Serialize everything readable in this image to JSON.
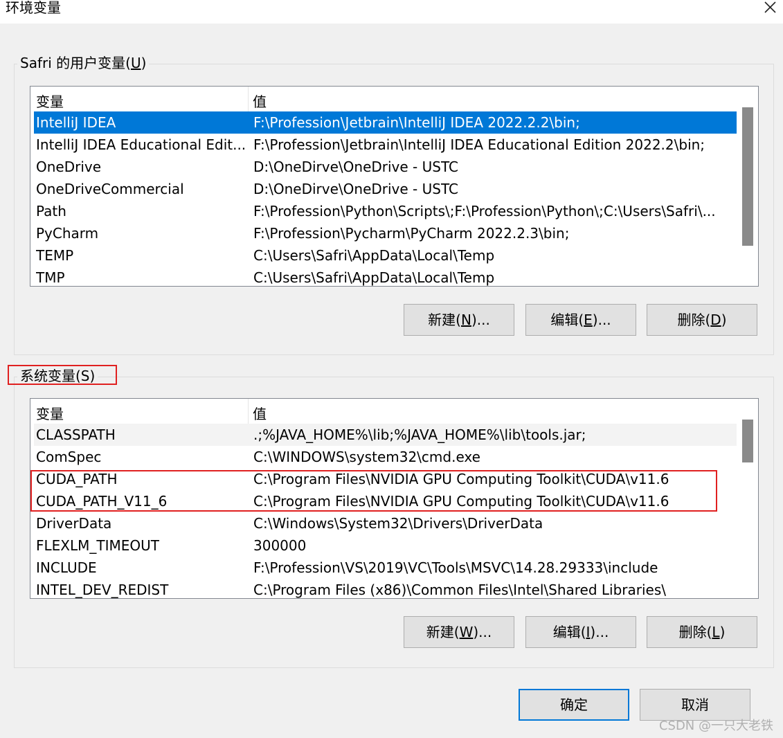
{
  "window": {
    "title": "环境变量",
    "close_icon": "close-icon"
  },
  "user_vars": {
    "group_label_prefix": "Safri 的用户变量(",
    "group_label_key": "U",
    "group_label_suffix": ")",
    "columns": [
      "变量",
      "值"
    ],
    "rows": [
      {
        "name": "IntelliJ IDEA",
        "value": "F:\\Profession\\Jetbrain\\IntelliJ IDEA 2022.2.2\\bin;"
      },
      {
        "name": "IntelliJ IDEA Educational Edit...",
        "value": "F:\\Profession\\Jetbrain\\IntelliJ IDEA Educational Edition 2022.2\\bin;"
      },
      {
        "name": "OneDrive",
        "value": "D:\\OneDirve\\OneDrive - USTC"
      },
      {
        "name": "OneDriveCommercial",
        "value": "D:\\OneDirve\\OneDrive - USTC"
      },
      {
        "name": "Path",
        "value": "F:\\Profession\\Python\\Scripts\\;F:\\Profession\\Python\\;C:\\Users\\Safri\\..."
      },
      {
        "name": "PyCharm",
        "value": "F:\\Profession\\Pycharm\\PyCharm 2022.2.3\\bin;"
      },
      {
        "name": "TEMP",
        "value": "C:\\Users\\Safri\\AppData\\Local\\Temp"
      },
      {
        "name": "TMP",
        "value": "C:\\Users\\Safri\\AppData\\Local\\Temp"
      }
    ],
    "selected_index": 0,
    "buttons": {
      "new": {
        "prefix": "新建(",
        "key": "N",
        "suffix": ")..."
      },
      "edit": {
        "prefix": "编辑(",
        "key": "E",
        "suffix": ")..."
      },
      "delete": {
        "prefix": "删除(",
        "key": "D",
        "suffix": ")"
      }
    }
  },
  "system_vars": {
    "group_label": "系统变量(S)",
    "columns": [
      "变量",
      "值"
    ],
    "rows": [
      {
        "name": "CLASSPATH",
        "value": ".;%JAVA_HOME%\\lib;%JAVA_HOME%\\lib\\tools.jar;"
      },
      {
        "name": "ComSpec",
        "value": "C:\\WINDOWS\\system32\\cmd.exe"
      },
      {
        "name": "CUDA_PATH",
        "value": "C:\\Program Files\\NVIDIA GPU Computing Toolkit\\CUDA\\v11.6"
      },
      {
        "name": "CUDA_PATH_V11_6",
        "value": "C:\\Program Files\\NVIDIA GPU Computing Toolkit\\CUDA\\v11.6"
      },
      {
        "name": "DriverData",
        "value": "C:\\Windows\\System32\\Drivers\\DriverData"
      },
      {
        "name": "FLEXLM_TIMEOUT",
        "value": "300000"
      },
      {
        "name": "INCLUDE",
        "value": "F:\\Profession\\VS\\2019\\VC\\Tools\\MSVC\\14.28.29333\\include"
      },
      {
        "name": "INTEL_DEV_REDIST",
        "value": "C:\\Program Files (x86)\\Common Files\\Intel\\Shared Libraries\\"
      }
    ],
    "buttons": {
      "new": {
        "prefix": "新建(",
        "key": "W",
        "suffix": ")..."
      },
      "edit": {
        "prefix": "编辑(",
        "key": "I",
        "suffix": ")..."
      },
      "delete": {
        "prefix": "删除(",
        "key": "L",
        "suffix": ")"
      }
    }
  },
  "footer": {
    "ok_label": "确定",
    "cancel_label": "取消"
  },
  "watermark": "CSDN @一只大老铁",
  "colors": {
    "selection": "#0078d7",
    "highlight_box": "#e02020"
  }
}
